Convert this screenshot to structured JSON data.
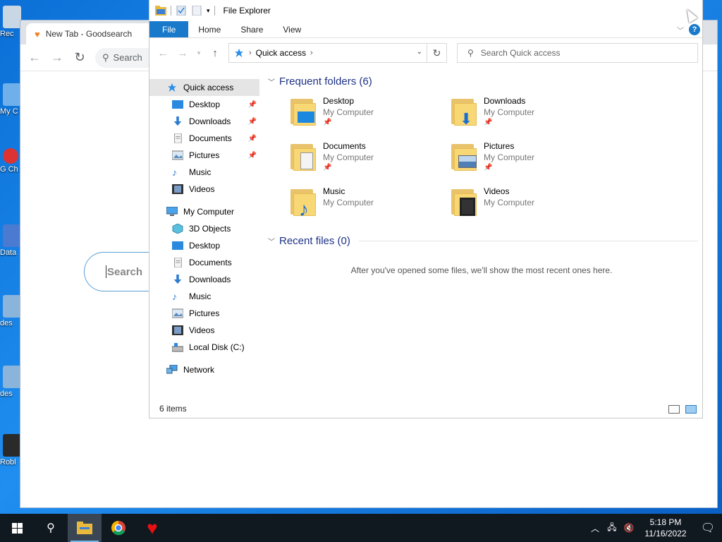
{
  "desktop": {
    "icons": [
      "Rec",
      "My C",
      "G Ch",
      "Data",
      "des",
      "des",
      "Robl"
    ]
  },
  "browser": {
    "tab_title": "New Tab - Goodsearch",
    "omnibox_text": "Search",
    "search_placeholder": "Search"
  },
  "explorer": {
    "title": "File Explorer",
    "ribbon_tabs": [
      "File",
      "Home",
      "Share",
      "View"
    ],
    "address": "Quick access",
    "search_placeholder": "Search Quick access",
    "nav": {
      "quick_access": "Quick access",
      "quick_items": [
        "Desktop",
        "Downloads",
        "Documents",
        "Pictures",
        "Music",
        "Videos"
      ],
      "my_computer": "My Computer",
      "computer_items": [
        "3D Objects",
        "Desktop",
        "Documents",
        "Downloads",
        "Music",
        "Pictures",
        "Videos",
        "Local Disk (C:)"
      ],
      "network": "Network"
    },
    "frequent_header": "Frequent folders (6)",
    "folders": [
      {
        "name": "Desktop",
        "location": "My Computer"
      },
      {
        "name": "Downloads",
        "location": "My Computer"
      },
      {
        "name": "Documents",
        "location": "My Computer"
      },
      {
        "name": "Pictures",
        "location": "My Computer"
      },
      {
        "name": "Music",
        "location": "My Computer"
      },
      {
        "name": "Videos",
        "location": "My Computer"
      }
    ],
    "recent_header": "Recent files (0)",
    "recent_empty": "After you've opened some files, we'll show the most recent ones here.",
    "status": "6 items"
  },
  "taskbar": {
    "time": "5:18 PM",
    "date": "11/16/2022"
  },
  "colors": {
    "accent": "#1979ca",
    "selection": "#cce8ff",
    "taskbar": "#101820"
  }
}
